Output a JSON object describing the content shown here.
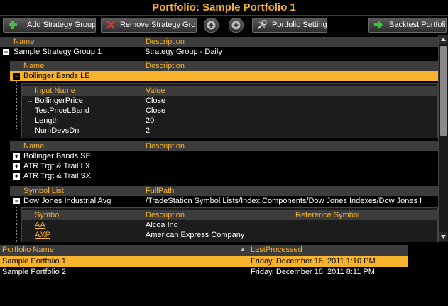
{
  "window": {
    "title": "Portfolio: Sample Portfolio 1"
  },
  "toolbar": {
    "add_group": "Add Strategy Group",
    "remove_group": "Remove Strategy Group",
    "settings": "Portfolio Settings",
    "backtest": "Backtest Portfolio"
  },
  "tree": {
    "header": {
      "name": "Name",
      "description": "Description"
    },
    "group": {
      "name": "Sample Strategy Group 1",
      "description": "Strategy Group - Daily"
    },
    "strategies_header": {
      "name": "Name",
      "description": "Description"
    },
    "selected_strategy": {
      "name": "Bollinger Bands LE",
      "description": ""
    },
    "inputs_header": {
      "name": "Input Name",
      "value": "Value"
    },
    "inputs": [
      {
        "name": "BollingerPrice",
        "value": "Close"
      },
      {
        "name": "TestPriceLBand",
        "value": "Close"
      },
      {
        "name": "Length",
        "value": "20"
      },
      {
        "name": "NumDevsDn",
        "value": "2"
      }
    ],
    "strategies2_header": {
      "name": "Name",
      "description": "Description"
    },
    "strategies": [
      {
        "name": "Bollinger Bands SE"
      },
      {
        "name": "ATR Trgt & Trail LX"
      },
      {
        "name": "ATR Trgt & Trail SX"
      }
    ],
    "symlist_header": {
      "name": "Symbol List",
      "path": "FullPath"
    },
    "symlist": {
      "name": "Dow Jones Industrial Avg",
      "path": "/TradeStation Symbol Lists/Index Components/Dow Jones Indexes/Dow Jones Industria..."
    },
    "symbols_header": {
      "symbol": "Symbol",
      "description": "Description",
      "reference": "Reference Symbol"
    },
    "symbols": [
      {
        "symbol": "AA",
        "description": "Alcoa Inc"
      },
      {
        "symbol": "AXP",
        "description": "American Express Company"
      }
    ]
  },
  "portfolios": {
    "header": {
      "name": "Portfolio Name",
      "processed": "LastProcessed"
    },
    "rows": [
      {
        "name": "Sample Portfolio 1",
        "processed": "Friday, December 16, 2011 1:10 PM"
      },
      {
        "name": "Sample Portfolio 2",
        "processed": "Friday, December 16, 2011 8:11 PM"
      }
    ]
  },
  "colors": {
    "accent": "#f7b32b",
    "header_bg": "#3c3c3c",
    "bg": "#000000"
  },
  "icons": [
    "plus-icon",
    "remove-x-icon",
    "up-arrow-icon",
    "down-arrow-icon",
    "tools-icon",
    "right-arrow-icon"
  ]
}
